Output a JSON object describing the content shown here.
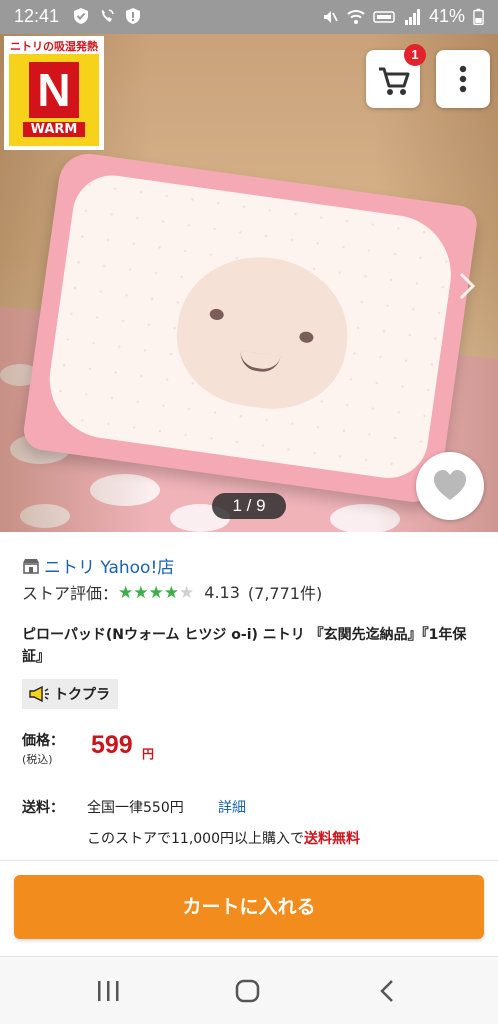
{
  "status_bar": {
    "time": "12:41",
    "battery": "41%"
  },
  "gallery": {
    "logo_top_text": "ニトリの吸湿発熱",
    "logo_letter": "N",
    "logo_bottom_text": "WARM",
    "cart_badge_count": "1",
    "counter": "1 / 9"
  },
  "product": {
    "store_name": "ニトリ Yahoo!店",
    "rating_label": "ストア評価：",
    "rating_stars": 4.13,
    "rating_value": "4.13",
    "rating_count": "(7,771件)",
    "title": "ピローパッド(Nウォーム ヒツジ o-i) ニトリ 『玄関先迄納品』『1年保証』",
    "badge": "トクプラ",
    "price_label": "価格：",
    "price_sub": "(税込)",
    "price_value": "599",
    "price_unit": "円",
    "shipping_label": "送料：",
    "shipping_value": "全国一律550円",
    "shipping_detail_link": "詳細",
    "shipping_note_prefix": "このストアで11,000円以上購入で",
    "shipping_note_free": "送料無料"
  },
  "actions": {
    "add_to_cart": "カートに入れる"
  },
  "colors": {
    "accent_orange": "#f28c1c",
    "price_red": "#c9161d",
    "link_blue": "#1961b5",
    "star_green": "#3fae49"
  }
}
